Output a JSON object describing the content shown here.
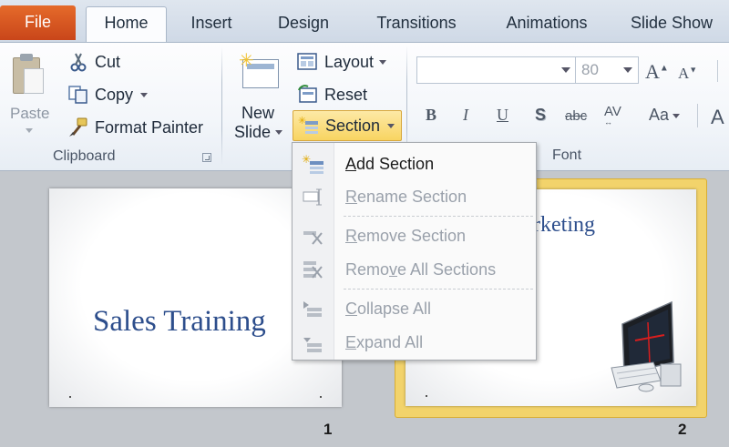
{
  "tabs": [
    "File",
    "Home",
    "Insert",
    "Design",
    "Transitions",
    "Animations",
    "Slide Show"
  ],
  "clipboard": {
    "paste": "Paste",
    "cut": "Cut",
    "copy": "Copy",
    "format_painter": "Format Painter",
    "group_label": "Clipboard"
  },
  "slides_group": {
    "new_slide_line1": "New",
    "new_slide_line2": "Slide",
    "layout": "Layout",
    "reset": "Reset",
    "section": "Section"
  },
  "font_group": {
    "font_name": "",
    "font_size": "80",
    "group_label": "Font",
    "bold": "B",
    "italic": "I",
    "underline": "U",
    "shadow": "S",
    "strikethrough": "abc",
    "spacing": "AV",
    "change_case": "Aa",
    "grow": "A",
    "shrink": "A"
  },
  "section_menu": {
    "items": [
      {
        "accel": "A",
        "rest": "dd Section",
        "enabled": true,
        "icon": "add-section-icon"
      },
      {
        "accel": "R",
        "rest": "ename Section",
        "enabled": false,
        "icon": "rename-section-icon"
      },
      {
        "accel": "R",
        "rest": "emove Section",
        "enabled": false,
        "icon": "remove-section-icon"
      },
      {
        "pre": "Remo",
        "accel": "v",
        "rest": "e All Sections",
        "enabled": false,
        "icon": "remove-all-sections-icon"
      },
      {
        "accel": "C",
        "rest": "ollapse All",
        "enabled": false,
        "icon": "collapse-all-icon"
      },
      {
        "accel": "E",
        "rest": "xpand All",
        "enabled": false,
        "icon": "expand-all-icon"
      }
    ]
  },
  "slides": [
    {
      "number": "1",
      "title": "Sales Training"
    },
    {
      "number": "2",
      "title": "rketing"
    }
  ],
  "colors": {
    "file_tab": "#d9561f",
    "section_highlight": "#f8d461",
    "slide_title": "#2d4e8c",
    "selected_slide_border": "#f2d36b"
  }
}
